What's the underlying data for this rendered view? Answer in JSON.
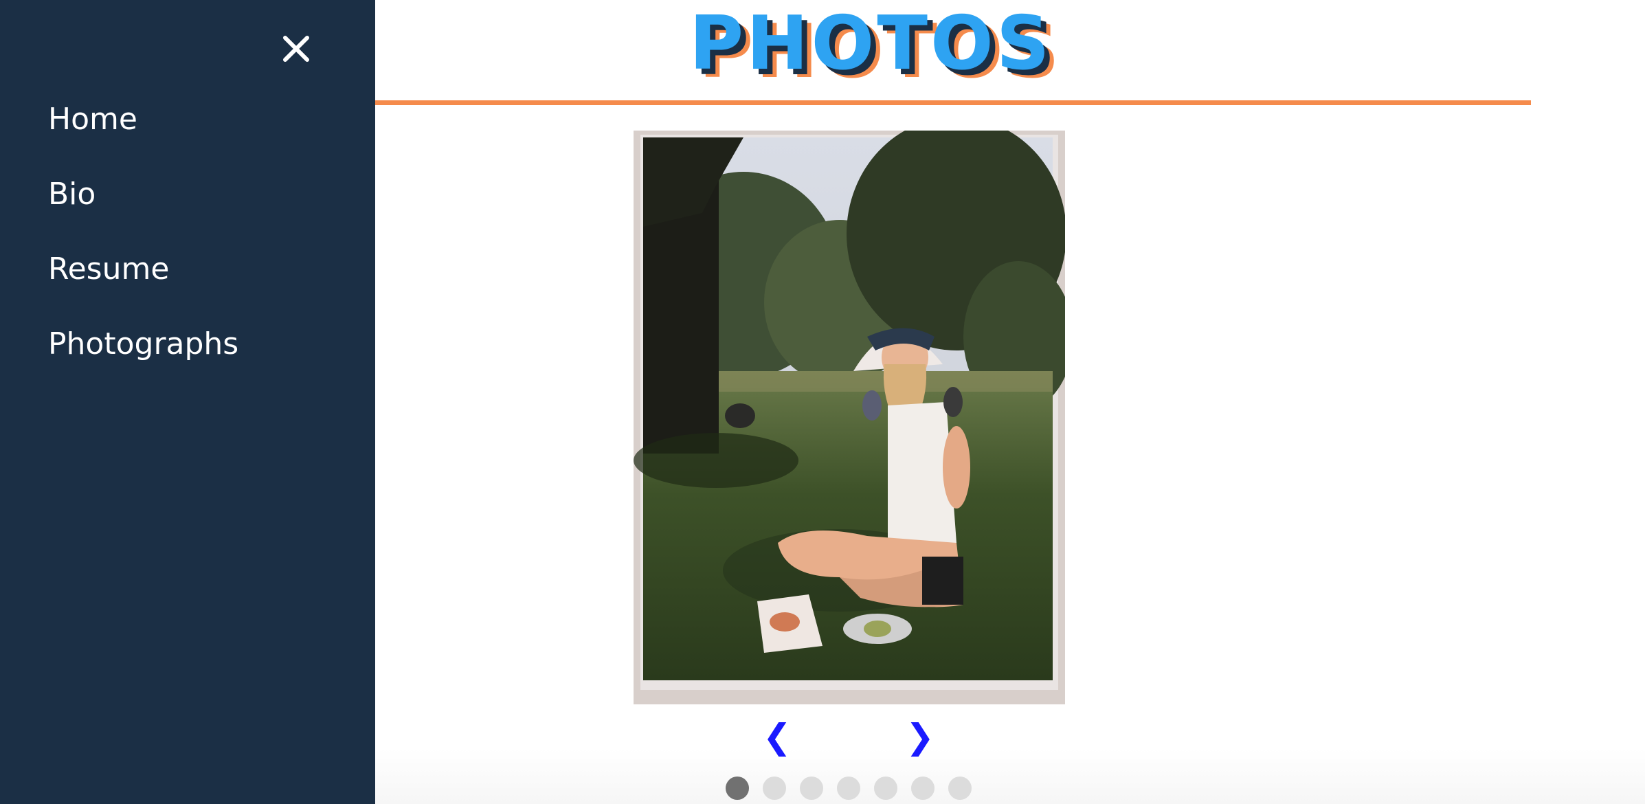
{
  "sidebar": {
    "close_glyph": "✕",
    "items": [
      {
        "label": "Home"
      },
      {
        "label": "Bio"
      },
      {
        "label": "Resume"
      },
      {
        "label": "Photographs"
      }
    ]
  },
  "header": {
    "title": "PHOTOS"
  },
  "slideshow": {
    "image_alt": "Photo of a woman sitting on the grass in a park",
    "prev_glyph": "❮",
    "next_glyph": "❯",
    "dots_count": 7,
    "active_index": 0
  },
  "colors": {
    "sidebar_bg": "#1b2f45",
    "accent_orange": "#f58b4c",
    "title_blue": "#2ea3f2",
    "arrow_blue": "#1a1aff",
    "dot_active": "#717171",
    "dot_inactive": "#dcdcdc"
  },
  "icons": {
    "close": "close-icon",
    "prev": "chevron-left-icon",
    "next": "chevron-right-icon"
  }
}
